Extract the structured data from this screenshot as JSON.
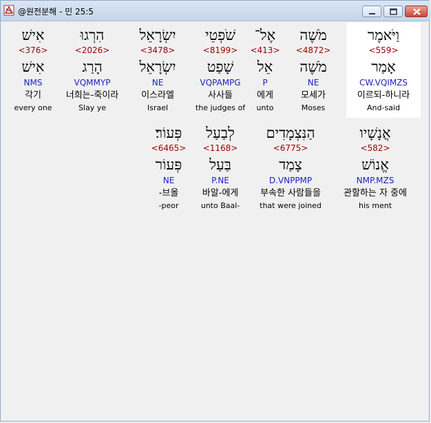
{
  "window": {
    "title": "@원전분해 - 민 25:5",
    "minimize_label": "minimize",
    "maximize_label": "maximize",
    "close_label": "close"
  },
  "colors": {
    "hebrew": "#000000",
    "strong": "#a00000",
    "morph": "#2020c0",
    "selected_bg": "#ffffff"
  },
  "rows": [
    {
      "words": [
        {
          "hebrew": "אִישׁ",
          "strong": "<376>",
          "lemma": "אִישׁ",
          "morph": "NMS",
          "korean": "각기",
          "english": "every one"
        },
        {
          "hebrew": "הִרְגוּ",
          "strong": "<2026>",
          "lemma": "הָרַג",
          "morph": "VQMMYP",
          "korean": "너희는-죽이라",
          "english": "Slay ye"
        },
        {
          "hebrew": "יִשְׂרָאֵל",
          "strong": "<3478>",
          "lemma": "יִשְׂרָאֵל",
          "morph": "NE",
          "korean": "이스라엘",
          "english": "Israel"
        },
        {
          "hebrew": "שֹׁפְטֵי",
          "strong": "<8199>",
          "lemma": "שָׁפַט",
          "morph": "VQPAMPG",
          "korean": "사사들",
          "english": "the judges of"
        },
        {
          "hebrew": "אֶל־",
          "strong": "<413>",
          "lemma": "אֵל",
          "morph": "P",
          "korean": "에게",
          "english": "unto"
        },
        {
          "hebrew": "מֹשֶׁה",
          "strong": "<4872>",
          "lemma": "מֹשֶׁה",
          "morph": "NE",
          "korean": "모세가",
          "english": "Moses"
        },
        {
          "hebrew": "וַיֹּאמֶר",
          "strong": "<559>",
          "lemma": "אָמַר",
          "morph": "CW.VQIMZS",
          "korean": "이르되-하니라",
          "english": "And-said"
        }
      ]
    },
    {
      "words": [
        {
          "hebrew": "פְּעוֹר׃",
          "strong": "<6465>",
          "lemma": "פְּעוֹר",
          "morph": "NE",
          "korean": "-브올",
          "english": "-peor"
        },
        {
          "hebrew": "לְבַעַל",
          "strong": "<1168>",
          "lemma": "בַּעַל",
          "morph": "P.NE",
          "korean": "바알-에게",
          "english": "unto Baal-"
        },
        {
          "hebrew": "הַנִּצְמָדִים",
          "strong": "<6775>",
          "lemma": "צָמַד",
          "morph": "D.VNPPMP",
          "korean": "부속한 사람들을",
          "english": "that were joined"
        },
        {
          "hebrew": "אֲנָשָׁיו",
          "strong": "<582>",
          "lemma": "אֱנוֹשׁ",
          "morph": "NMP.MZS",
          "korean": "관할하는 자 중에",
          "english": "his ment"
        }
      ]
    }
  ]
}
